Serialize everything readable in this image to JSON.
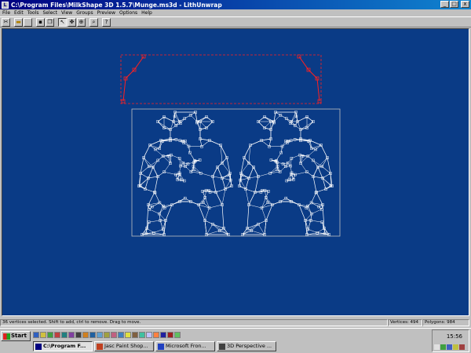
{
  "window": {
    "title": "C:\\Program Files\\MilkShape 3D 1.5.7\\Munge.ms3d - LithUnwrap",
    "app_icon": "L",
    "minimize": "_",
    "maximize": "□",
    "close": "x"
  },
  "menu": [
    "File",
    "Edit",
    "Tools",
    "Select",
    "View",
    "Groups",
    "Preview",
    "Options",
    "Help"
  ],
  "toolbar": {
    "buttons": [
      {
        "name": "cut-icon",
        "glyph": "✂"
      },
      {
        "name": "open-icon",
        "glyph": "▬"
      },
      {
        "name": "blank-icon",
        "glyph": ""
      },
      {
        "name": "save-icon",
        "glyph": "▪"
      },
      {
        "name": "copy-icon",
        "glyph": "❐"
      },
      {
        "name": "arrow-select-icon",
        "glyph": "↖"
      },
      {
        "name": "move-icon",
        "glyph": "✥"
      },
      {
        "name": "zoom-icon",
        "glyph": "⊕"
      },
      {
        "name": "zoom-region-icon",
        "glyph": "⌕"
      },
      {
        "name": "help-icon",
        "glyph": "?"
      }
    ]
  },
  "status": {
    "message": "36 vertices selected. Shift to add, ctrl to remove. Drag to move.",
    "vertices": "Vertices: 494",
    "polygons": "Polygons: 984"
  },
  "taskbar": {
    "start": "Start",
    "tasks": [
      {
        "label": "C:\\Program F...",
        "active": true,
        "color": "#000080"
      },
      {
        "label": "Jasc Paint Shop...",
        "active": false,
        "color": "#c04020"
      },
      {
        "label": "Microsoft Fron...",
        "active": false,
        "color": "#2040c0"
      },
      {
        "label": "3D Perspective ...",
        "active": false,
        "color": "#404040"
      }
    ],
    "clock": "15:56"
  },
  "colors": {
    "canvas_bg": "#0a3b86",
    "mesh": "#ffffff",
    "selection": "#ff2020"
  }
}
